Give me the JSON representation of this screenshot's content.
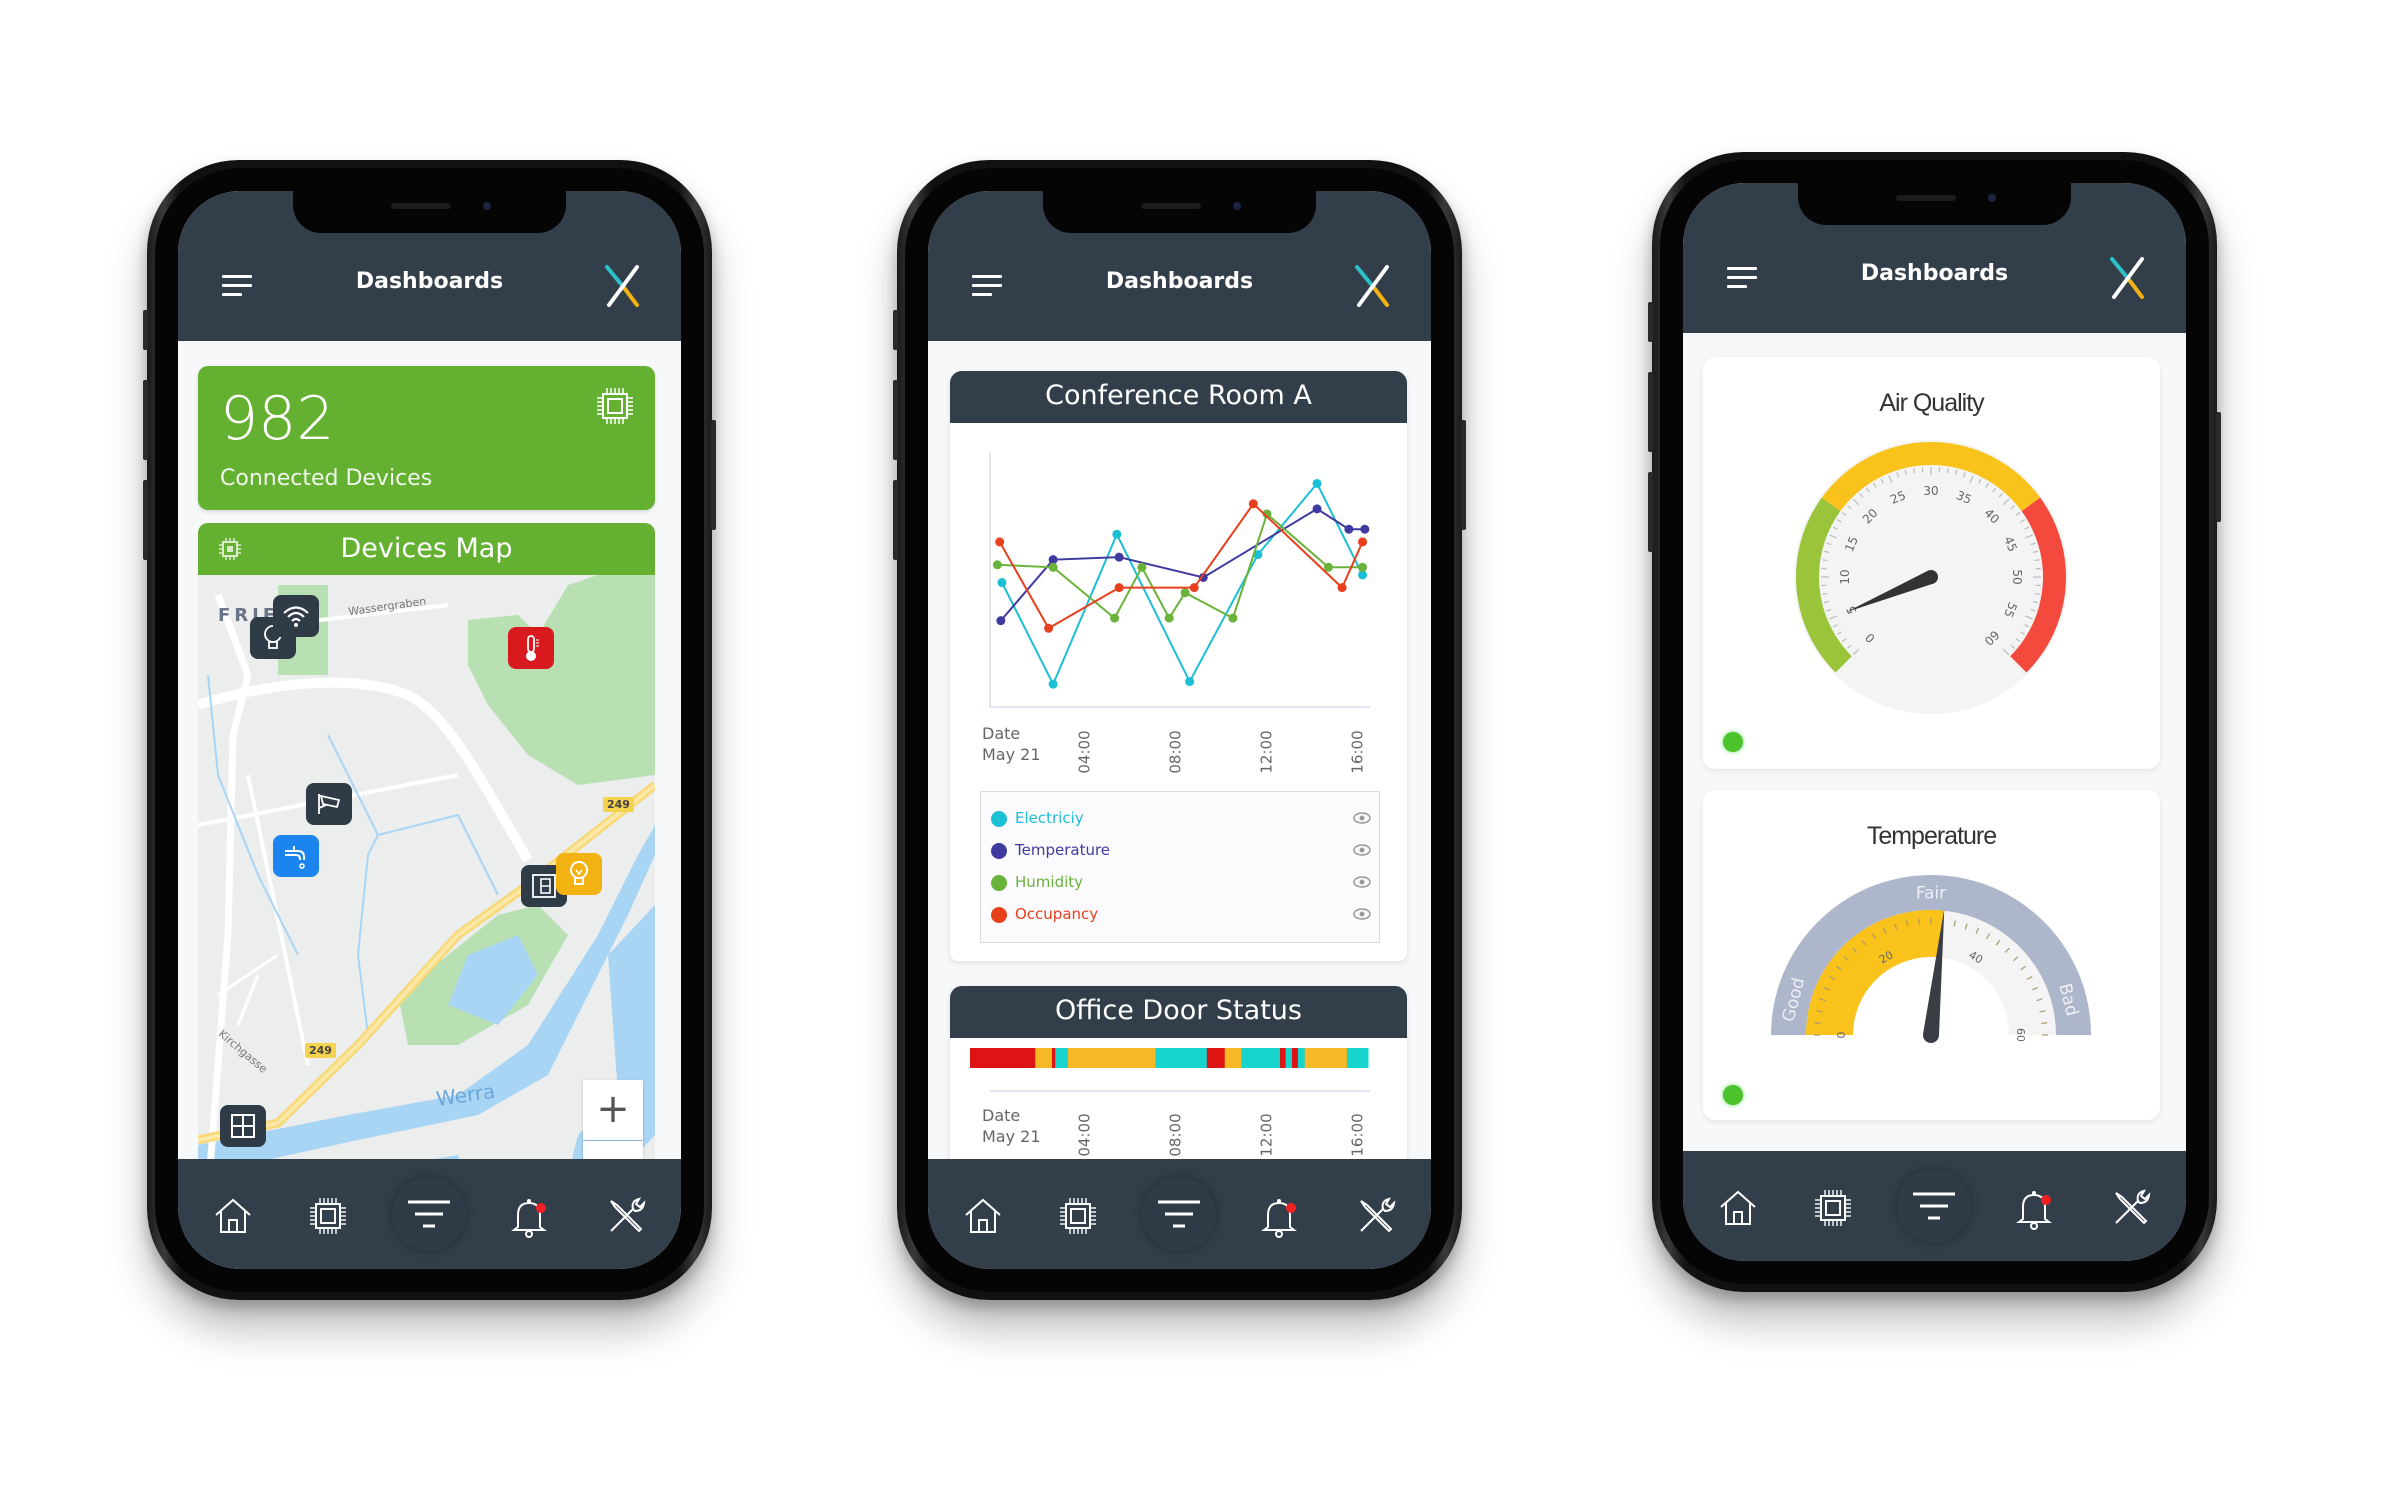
{
  "header": {
    "title": "Dashboards",
    "menu_icon": "hamburger-icon",
    "logo": "x-logo"
  },
  "nav": {
    "items": [
      {
        "icon": "home-icon",
        "label": "Home"
      },
      {
        "icon": "chip-icon",
        "label": "Devices"
      },
      {
        "icon": "filter-icon",
        "label": "Dashboards"
      },
      {
        "icon": "bell-icon",
        "label": "Notifications",
        "badge": true
      },
      {
        "icon": "tools-icon",
        "label": "Settings"
      }
    ]
  },
  "phone1": {
    "stat": {
      "value": "982",
      "label": "Connected Devices",
      "icon": "chip-icon",
      "color": "#64b132"
    },
    "map": {
      "title": "Devices Map",
      "labels": {
        "town": "FRIE",
        "street1": "Wassergraben",
        "street2": "Kirchgasse",
        "river": "Werra",
        "road": "249"
      },
      "pins": [
        {
          "type": "lightbulb",
          "color": "dark"
        },
        {
          "type": "wifi",
          "color": "dark"
        },
        {
          "type": "thermometer",
          "color": "red"
        },
        {
          "type": "camera",
          "color": "dark"
        },
        {
          "type": "faucet",
          "color": "blue"
        },
        {
          "type": "door-panel",
          "color": "dark"
        },
        {
          "type": "lightbulb",
          "color": "yellow"
        },
        {
          "type": "window",
          "color": "dark"
        }
      ],
      "zoom_in": "+",
      "zoom_out": "−"
    }
  },
  "phone2": {
    "chart_title": "Conference Room A",
    "door_title": "Office Door Status",
    "date_label": "Date",
    "date_value": "May 21",
    "legend": [
      {
        "label": "Electriciy",
        "color": "#1bbfd6"
      },
      {
        "label": "Temperature",
        "color": "#3f3aa0"
      },
      {
        "label": "Humidity",
        "color": "#6ab33a"
      },
      {
        "label": "Occupancy",
        "color": "#e8401c"
      }
    ],
    "ticks": [
      "04:00",
      "08:00",
      "12:00",
      "16:00"
    ]
  },
  "phone3": {
    "air_quality": {
      "title": "Air Quality",
      "value": 5,
      "min": 0,
      "max": 60,
      "ticks": [
        "0",
        "5",
        "10",
        "15",
        "20",
        "25",
        "30",
        "35",
        "40",
        "45",
        "50",
        "55",
        "60"
      ],
      "bands": [
        {
          "from": 0,
          "to": 18,
          "color": "#9ac43a"
        },
        {
          "from": 18,
          "to": 42,
          "color": "#f9c31c"
        },
        {
          "from": 42,
          "to": 60,
          "color": "#f44a3e"
        }
      ],
      "status_color": "#4cc22c"
    },
    "temperature": {
      "title": "Temperature",
      "value": 32,
      "min": 0,
      "max": 60,
      "ticks": [
        "0",
        "20",
        "40",
        "60"
      ],
      "zones": [
        "Good",
        "Fair",
        "Bad"
      ],
      "fill_color": "#f9c31c",
      "zone_color": "#aeb6cb",
      "status_color": "#4cc22c"
    }
  },
  "chart_data": [
    {
      "type": "line",
      "title": "Conference Room A",
      "xlabel": "Date May 21",
      "ylabel": "",
      "x_unit": "hours",
      "xlim": [
        0,
        17
      ],
      "ylim": [
        0,
        100
      ],
      "x_ticks": [
        "04:00",
        "08:00",
        "12:00",
        "16:00"
      ],
      "grid": false,
      "legend": "bottom",
      "series": [
        {
          "name": "Electriciy",
          "color": "#1bbfd6",
          "x": [
            0.35,
            2.6,
            5.4,
            8.6,
            11.6,
            14.2,
            16.2
          ],
          "y": [
            49,
            9,
            68,
            10,
            60,
            88,
            52
          ]
        },
        {
          "name": "Temperature",
          "color": "#3f3aa0",
          "x": [
            0.3,
            2.6,
            5.5,
            9.2,
            14.2,
            15.6,
            16.3
          ],
          "y": [
            34,
            58,
            59,
            51,
            78,
            70,
            70
          ]
        },
        {
          "name": "Humidity",
          "color": "#6ab33a",
          "x": [
            0.15,
            2.6,
            5.3,
            6.5,
            7.7,
            8.4,
            10.5,
            12.0,
            14.7,
            16.2
          ],
          "y": [
            56,
            55,
            35,
            55,
            35,
            45,
            35,
            76,
            55,
            55
          ]
        },
        {
          "name": "Occupancy",
          "color": "#e8401c",
          "x": [
            0.25,
            2.4,
            5.5,
            8.8,
            11.4,
            15.3,
            16.2
          ],
          "y": [
            65,
            31,
            47,
            47,
            80,
            47,
            65
          ]
        }
      ]
    },
    {
      "type": "bar",
      "title": "Office Door Status",
      "xlabel": "Date May 21",
      "x_ticks": [
        "04:00",
        "08:00",
        "12:00",
        "16:00"
      ],
      "segments": [
        {
          "from": 0.0,
          "to": 16.4,
          "color": "#de1313"
        },
        {
          "from": 16.4,
          "to": 20.6,
          "color": "#f6b824"
        },
        {
          "from": 20.6,
          "to": 21.4,
          "color": "#de1313"
        },
        {
          "from": 21.4,
          "to": 24.6,
          "color": "#17d4cf"
        },
        {
          "from": 24.6,
          "to": 46.6,
          "color": "#f6b824"
        },
        {
          "from": 46.6,
          "to": 59.5,
          "color": "#17d4cf"
        },
        {
          "from": 59.5,
          "to": 64.0,
          "color": "#de1313"
        },
        {
          "from": 64.0,
          "to": 68.2,
          "color": "#f6b824"
        },
        {
          "from": 68.2,
          "to": 77.9,
          "color": "#17d4cf"
        },
        {
          "from": 77.9,
          "to": 79.3,
          "color": "#de1313"
        },
        {
          "from": 79.3,
          "to": 80.9,
          "color": "#17d4cf"
        },
        {
          "from": 80.9,
          "to": 82.4,
          "color": "#de1313"
        },
        {
          "from": 82.4,
          "to": 84.1,
          "color": "#17d4cf"
        },
        {
          "from": 84.1,
          "to": 94.7,
          "color": "#f6b824"
        },
        {
          "from": 94.7,
          "to": 100.0,
          "color": "#17d4cf"
        }
      ],
      "unit": "percent of timeline"
    }
  ]
}
